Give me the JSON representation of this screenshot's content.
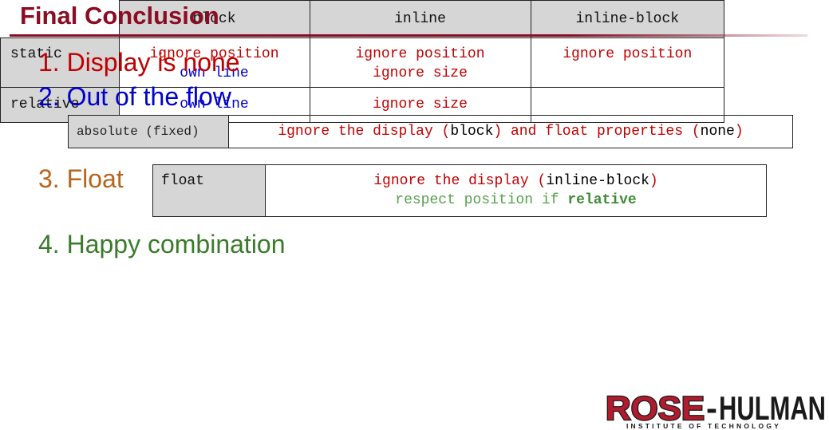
{
  "title": "Final Conclusion",
  "items": {
    "item1": "1. Display is none",
    "item2": "2. Out of the flow",
    "item3": "3. Float",
    "item4": "4. Happy combination"
  },
  "absolute_row": {
    "key": "absolute (fixed)",
    "text_a": "ignore the display ",
    "paren_open": "(",
    "display_value": "block",
    "paren_close": ")",
    "text_b": " and float properties ",
    "paren_open2": "(",
    "float_value": "none",
    "paren_close2": ")"
  },
  "float_row": {
    "key": "float",
    "line1_a": "ignore the display ",
    "paren_open": "(",
    "display_value": "inline-block",
    "paren_close": ")",
    "line2_a": "respect position if ",
    "line2_b": "relative"
  },
  "combo": {
    "headers": [
      "block",
      "inline",
      "inline-block"
    ],
    "rows": [
      {
        "label": "static",
        "block": [
          "ignore position",
          "own line"
        ],
        "inline": [
          "ignore position",
          "ignore size"
        ],
        "inline_block": [
          "ignore position"
        ]
      },
      {
        "label": "relative",
        "block": [
          "own line"
        ],
        "inline": [
          "ignore size"
        ],
        "inline_block": []
      }
    ]
  },
  "logo": {
    "name": "ROSE-HULMAN",
    "tagline": "INSTITUTE OF TECHNOLOGY",
    "colors": {
      "red": "#b01c2e",
      "black": "#1a1a1a"
    }
  }
}
